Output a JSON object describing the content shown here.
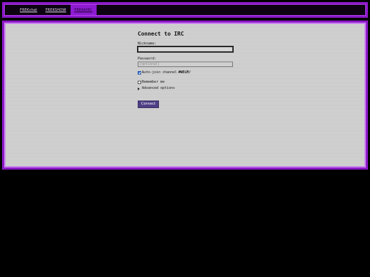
{
  "nav": {
    "links": [
      {
        "label": "FREKchat"
      },
      {
        "label": "FREKSHOW"
      },
      {
        "label": "FREAKIRC"
      }
    ],
    "active_index": 2
  },
  "form": {
    "title": "Connect to IRC",
    "nickname_label": "Nickname:",
    "nickname_value": "",
    "password_label": "Password:",
    "password_placeholder": "(optional)",
    "autojoin_label": "Auto-join channel",
    "autojoin_channel": "#WELM/",
    "autojoin_checked": true,
    "remember_label": "Remember me",
    "remember_checked": false,
    "advanced_label": "Advanced options",
    "connect_label": "Connect"
  },
  "colors": {
    "frame_purple": "#8a18c6",
    "button_purple": "#4f3f86"
  }
}
